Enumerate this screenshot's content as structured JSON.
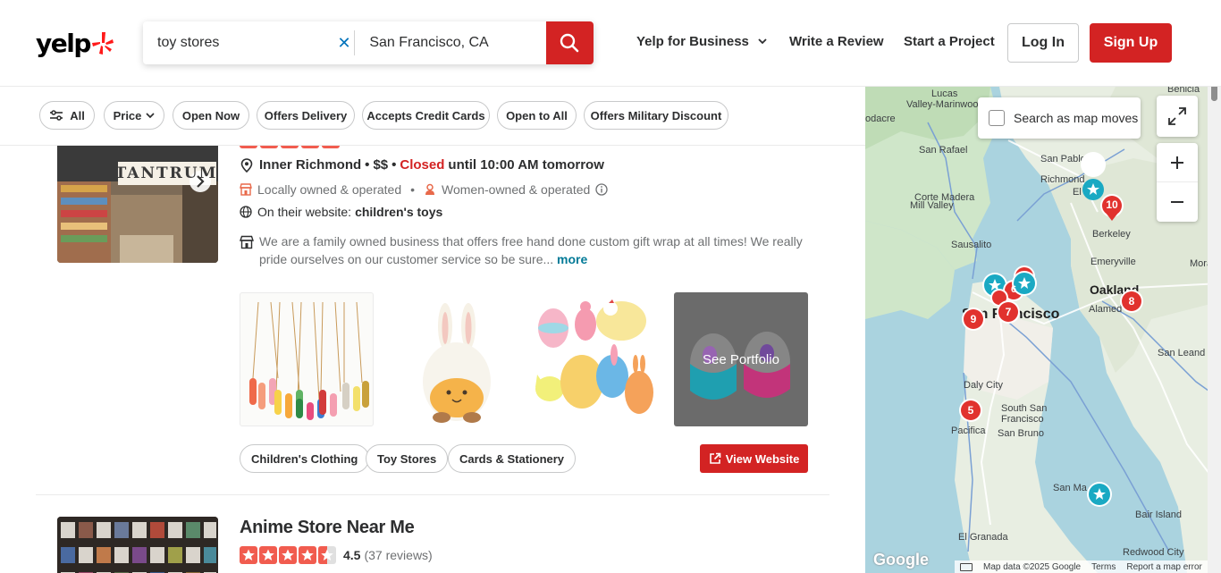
{
  "header": {
    "logo_text": "yelp",
    "search_what": "toy stores",
    "search_where": "San Francisco, CA",
    "nav": {
      "business": "Yelp for Business",
      "write_review": "Write a Review",
      "start_project": "Start a Project",
      "login": "Log In",
      "signup": "Sign Up"
    }
  },
  "filters": [
    "All",
    "Price",
    "Open Now",
    "Offers Delivery",
    "Accepts Credit Cards",
    "Open to All",
    "Offers Military Discount"
  ],
  "listing1": {
    "sign_text": "TANTRUM",
    "neighborhood": "Inner Richmond",
    "price": "$$",
    "status": "Closed",
    "hours": "until 10:00 AM tomorrow",
    "attr_local": "Locally owned & operated",
    "attr_women": "Women-owned & operated",
    "website_prefix": "On their website:",
    "website_term": "children's toys",
    "snippet": "We are a family owned business that offers free hand done custom gift wrap at all times! We really pride ourselves on our customer service so be sure...",
    "more": "more",
    "portfolio_label": "See Portfolio",
    "tags": [
      "Children's Clothing",
      "Toy Stores",
      "Cards & Stationery"
    ],
    "view_website": "View Website"
  },
  "listing2": {
    "name": "Anime Store Near Me",
    "rating": "4.5",
    "reviews": "(37 reviews)",
    "stars": 4.5
  },
  "map": {
    "search_as_moves": "Search as map moves",
    "places": {
      "lucas": "Lucas",
      "valley": "Valley-Marinwood",
      "bodacre": "odacre",
      "sanrafael": "San Rafael",
      "sanpablo": "San Pablo",
      "richmond": "Richmond",
      "elcerrito": "El Ce",
      "cortemadera": "Corte Madera",
      "millvalley": "Mill Valley",
      "berkeley": "Berkeley",
      "sausalito": "Sausalito",
      "emeryville": "Emeryville",
      "oakland": "Oakland",
      "alameda": "Alamed",
      "sanfrancisco": "San Francisco",
      "sanleandro": "San Leand",
      "dalycity": "Daly City",
      "southsf1": "South San",
      "southsf2": "Francisco",
      "pacifica": "Pacifica",
      "sanbruno": "San Bruno",
      "sanmateo": "San Ma",
      "bairisland": "Bair Island",
      "elgranada": "El Granada",
      "redwood": "Redwood City",
      "benicia": "Benicia",
      "mora": "Mora"
    },
    "markers": [
      "10",
      "9",
      "7",
      "8",
      "5",
      "6"
    ],
    "google": "Google",
    "footer": {
      "mapdata": "Map data ©2025 Google",
      "terms": "Terms",
      "report": "Report a map error"
    }
  },
  "colors": {
    "brand_red": "#d32323",
    "link_blue": "#0073bb",
    "teal_marker": "#10a5c6",
    "closed_red": "#d32323"
  }
}
